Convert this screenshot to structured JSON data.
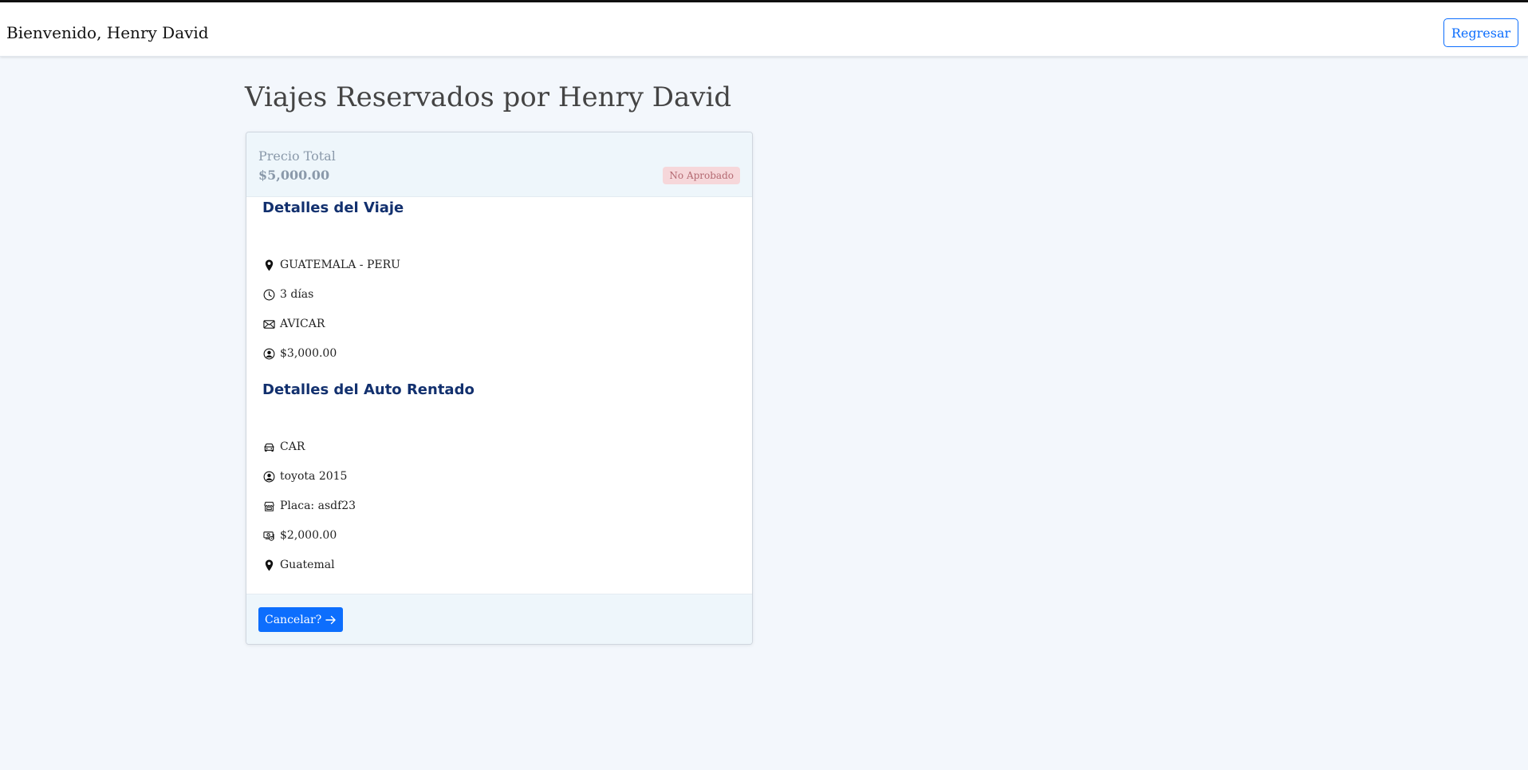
{
  "header": {
    "welcome": "Bienvenido, Henry David",
    "back_label": "Regresar"
  },
  "page": {
    "title": "Viajes Reservados por Henry David"
  },
  "card": {
    "price_label": "Precio Total",
    "price_value": "$5,000.00",
    "status": "No Aprobado",
    "trip_section_title": "Detalles del Viaje",
    "trip_details": [
      {
        "icon": "location-pin-icon",
        "text": "GUATEMALA - PERU"
      },
      {
        "icon": "clock-icon",
        "text": "3 días"
      },
      {
        "icon": "envelope-icon",
        "text": "AVICAR"
      },
      {
        "icon": "person-circle-icon",
        "text": "$3,000.00"
      }
    ],
    "car_section_title": "Detalles del Auto Rentado",
    "car_details": [
      {
        "icon": "car-icon",
        "text": "CAR"
      },
      {
        "icon": "person-circle-icon",
        "text": "toyota 2015"
      },
      {
        "icon": "shop-icon",
        "text": "Placa: asdf23"
      },
      {
        "icon": "cash-icon",
        "text": "$2,000.00"
      },
      {
        "icon": "location-pin-icon",
        "text": "Guatemal"
      }
    ],
    "cancel_label": "Cancelar?"
  },
  "colors": {
    "accent": "#0d6efd",
    "section_title": "#12306e",
    "badge_bg": "#f6d7da",
    "badge_text": "#b46a72",
    "page_bg": "#f3f7fc"
  }
}
